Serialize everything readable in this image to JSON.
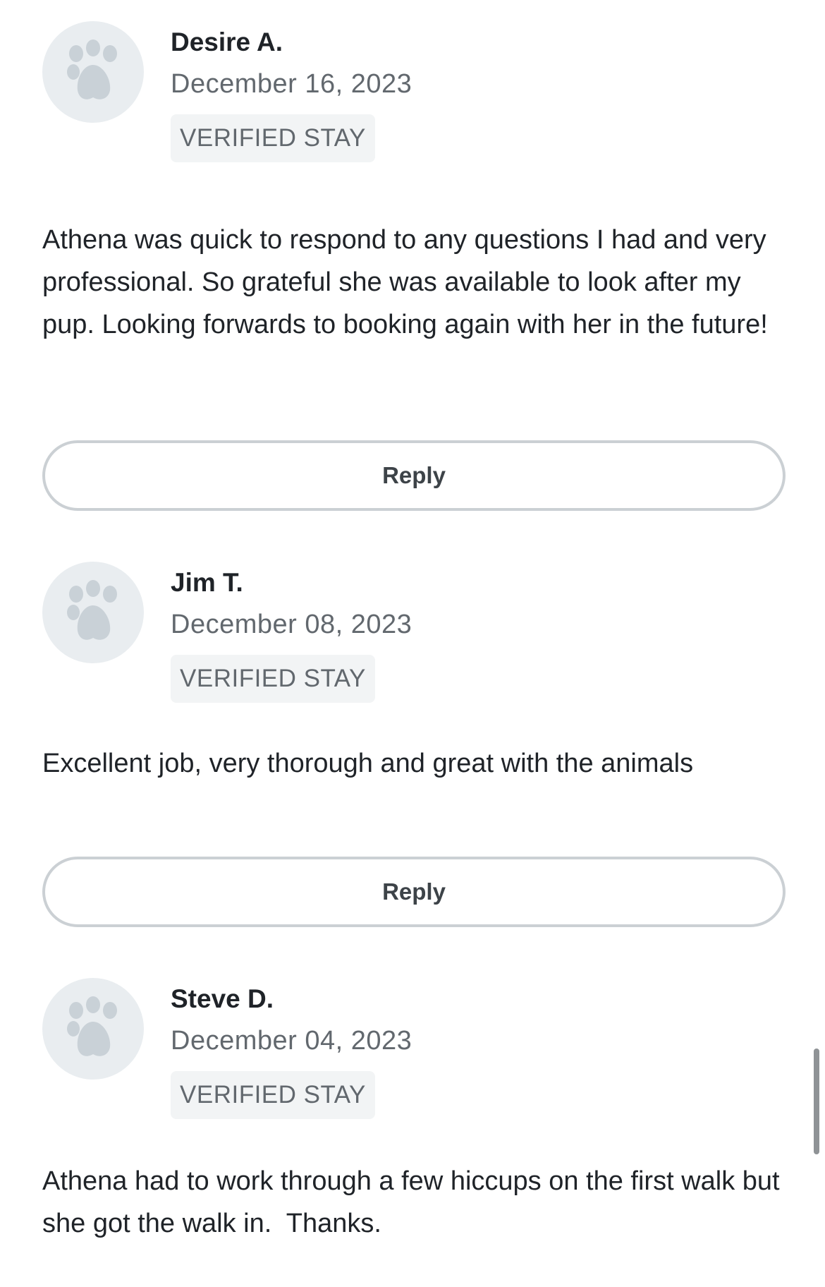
{
  "reviews": [
    {
      "name": "Desire A.",
      "date": "December 16, 2023",
      "badge": "VERIFIED STAY",
      "text": "Athena was quick to respond to any questions I had and very professional. So grateful she was available to look after my pup. Looking forwards to booking again with her in the future!",
      "reply_label": "Reply",
      "avatar_icon": "paw-icon"
    },
    {
      "name": "Jim T.",
      "date": "December 08, 2023",
      "badge": "VERIFIED STAY",
      "text": "Excellent job, very thorough and great with the animals",
      "reply_label": "Reply",
      "avatar_icon": "paw-icon"
    },
    {
      "name": "Steve D.",
      "date": "December 04, 2023",
      "badge": "VERIFIED STAY",
      "text": "Athena had to work through a few hiccups on the first walk but she got the walk in.  Thanks.",
      "avatar_icon": "paw-icon"
    }
  ],
  "colors": {
    "avatar_bg": "#e9edf0",
    "paw": "#c9d1d7",
    "badge_bg": "#f2f4f5",
    "reply_border": "#cbd0d4"
  }
}
